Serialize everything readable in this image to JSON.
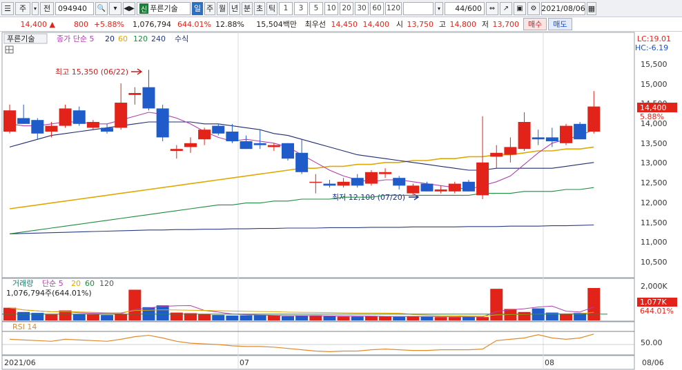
{
  "toolbar": {
    "market_type": "주",
    "prev_label": "전",
    "stock_code": "094940",
    "search_icon": "search-icon",
    "code_history_icon": "history-icon",
    "nav_icon": "arrows-icon",
    "sin_badge": "신",
    "stock_name": "푸른기술",
    "periods": [
      "일",
      "주",
      "월",
      "년",
      "분",
      "초",
      "틱"
    ],
    "active_period": "일",
    "intervals": [
      "1",
      "3",
      "5",
      "10",
      "20",
      "30",
      "60",
      "120"
    ],
    "count_value": "44",
    "count_total": "/600",
    "date": "2021/08/06"
  },
  "quote": {
    "price": "14,400",
    "change": "800",
    "change_pct": "+5.88%",
    "volume": "1,076,794",
    "volume_ratio": "644.01%",
    "turnover": "12.88%",
    "amount": "15,504백만",
    "best_label": "최우선",
    "ask": "14,450",
    "bid": "14,400",
    "open_label": "시",
    "open": "13,750",
    "high_label": "고",
    "high": "14,800",
    "low_label": "저",
    "low": "13,700",
    "buy_label": "매수",
    "sell_label": "매도"
  },
  "legend": {
    "stock_name": "푸른기술",
    "price_ma_prefix": "종가 단순 5",
    "ma_periods": [
      "20",
      "60",
      "120",
      "240"
    ],
    "formula_label": "수식",
    "lc_label": "LC:19.01",
    "hc_label": "HC:-6.19"
  },
  "annotations": {
    "high_note": "최고 15,350 (06/22)",
    "low_note": "최저 12,100 (07/20)"
  },
  "price_axis": {
    "ticks": [
      "15,500",
      "15,000",
      "14,500",
      "14,000",
      "13,500",
      "13,000",
      "12,500",
      "12,000",
      "11,500",
      "11,000",
      "10,500"
    ],
    "current_price": "14,400",
    "current_pct": "5.88%"
  },
  "volume_panel": {
    "title": "거래량",
    "ma_prefix": "단순 5",
    "ma_periods": [
      "20",
      "60",
      "120"
    ],
    "info": "1,076,794주(644.01%)",
    "tick_top": "2,000K",
    "current_volume": "1,077K",
    "current_pct": "644.01%"
  },
  "rsi_panel": {
    "title": "RSI 14",
    "tick": "50.00"
  },
  "x_axis": {
    "labels": [
      "2021/06",
      "07",
      "08"
    ],
    "right_label": "08/06"
  },
  "colors": {
    "up": "#e2231a",
    "down": "#1f5cc9",
    "ma5": "#b040b0",
    "ma20": "#1e2a6e",
    "ma60": "#e0a800",
    "ma120": "#1c8a3c",
    "ma240": "#2a3a80",
    "rsi": "#e08a2a"
  },
  "chart_data": {
    "type": "candlestick",
    "x_range": [
      "2021/06",
      "2021/08/06"
    ],
    "y_range": [
      10300,
      15700
    ],
    "candles": [
      {
        "o": 13750,
        "h": 14450,
        "l": 13700,
        "c": 14300
      },
      {
        "o": 14100,
        "h": 14450,
        "l": 13950,
        "c": 13950
      },
      {
        "o": 14050,
        "h": 14100,
        "l": 13550,
        "c": 13700
      },
      {
        "o": 13750,
        "h": 14000,
        "l": 13600,
        "c": 13900
      },
      {
        "o": 13900,
        "h": 14450,
        "l": 13850,
        "c": 14350
      },
      {
        "o": 14300,
        "h": 14400,
        "l": 13900,
        "c": 13950
      },
      {
        "o": 13850,
        "h": 14050,
        "l": 13800,
        "c": 14000
      },
      {
        "o": 13850,
        "h": 13950,
        "l": 13700,
        "c": 13750
      },
      {
        "o": 13850,
        "h": 15000,
        "l": 13800,
        "c": 14500
      },
      {
        "o": 14700,
        "h": 14900,
        "l": 14450,
        "c": 14750
      },
      {
        "o": 14900,
        "h": 15350,
        "l": 14300,
        "c": 14350
      },
      {
        "o": 14350,
        "h": 14450,
        "l": 13500,
        "c": 13600
      },
      {
        "o": 13250,
        "h": 13400,
        "l": 13050,
        "c": 13300
      },
      {
        "o": 13350,
        "h": 13600,
        "l": 13200,
        "c": 13450
      },
      {
        "o": 13550,
        "h": 13850,
        "l": 13400,
        "c": 13800
      },
      {
        "o": 13900,
        "h": 13950,
        "l": 13650,
        "c": 13700
      },
      {
        "o": 13750,
        "h": 13950,
        "l": 13450,
        "c": 13500
      },
      {
        "o": 13500,
        "h": 13650,
        "l": 13300,
        "c": 13300
      },
      {
        "o": 13450,
        "h": 13800,
        "l": 13300,
        "c": 13400
      },
      {
        "o": 13350,
        "h": 13450,
        "l": 13250,
        "c": 13400
      },
      {
        "o": 13450,
        "h": 13450,
        "l": 13000,
        "c": 13050
      },
      {
        "o": 13200,
        "h": 13550,
        "l": 12650,
        "c": 12700
      },
      {
        "o": 12450,
        "h": 12650,
        "l": 12150,
        "c": 12450
      },
      {
        "o": 12400,
        "h": 12500,
        "l": 12300,
        "c": 12350
      },
      {
        "o": 12350,
        "h": 12550,
        "l": 12300,
        "c": 12450
      },
      {
        "o": 12550,
        "h": 12650,
        "l": 12300,
        "c": 12350
      },
      {
        "o": 12400,
        "h": 12750,
        "l": 12350,
        "c": 12700
      },
      {
        "o": 12650,
        "h": 12800,
        "l": 12550,
        "c": 12700
      },
      {
        "o": 12550,
        "h": 12600,
        "l": 12250,
        "c": 12350
      },
      {
        "o": 12150,
        "h": 12400,
        "l": 12100,
        "c": 12350
      },
      {
        "o": 12400,
        "h": 12450,
        "l": 12200,
        "c": 12200
      },
      {
        "o": 12200,
        "h": 12350,
        "l": 12150,
        "c": 12250
      },
      {
        "o": 12200,
        "h": 12450,
        "l": 12150,
        "c": 12400
      },
      {
        "o": 12450,
        "h": 12500,
        "l": 12200,
        "c": 12200
      },
      {
        "o": 12100,
        "h": 14150,
        "l": 12000,
        "c": 12950
      },
      {
        "o": 13100,
        "h": 13400,
        "l": 12800,
        "c": 13200
      },
      {
        "o": 13150,
        "h": 13600,
        "l": 12950,
        "c": 13350
      },
      {
        "o": 13300,
        "h": 14250,
        "l": 13250,
        "c": 14000
      },
      {
        "o": 13600,
        "h": 13800,
        "l": 13400,
        "c": 13550
      },
      {
        "o": 13600,
        "h": 13850,
        "l": 13350,
        "c": 13500
      },
      {
        "o": 13450,
        "h": 13950,
        "l": 13400,
        "c": 13900
      },
      {
        "o": 13950,
        "h": 14000,
        "l": 13550,
        "c": 13550
      },
      {
        "o": 13750,
        "h": 14800,
        "l": 13700,
        "c": 14400
      }
    ],
    "ma5": [
      13950,
      13900,
      13900,
      13950,
      14000,
      14000,
      13950,
      13950,
      14050,
      14150,
      14250,
      14200,
      14100,
      13950,
      13750,
      13600,
      13500,
      13550,
      13500,
      13450,
      13350,
      13150,
      12950,
      12750,
      12600,
      12500,
      12450,
      12500,
      12500,
      12450,
      12400,
      12350,
      12300,
      12250,
      12350,
      12450,
      12600,
      12900,
      13200,
      13450,
      13550,
      13650,
      13800
    ],
    "ma20": [
      13350,
      13450,
      13550,
      13650,
      13700,
      13750,
      13800,
      13850,
      13900,
      13950,
      14000,
      14000,
      14000,
      14000,
      13950,
      13950,
      13900,
      13850,
      13800,
      13700,
      13650,
      13550,
      13450,
      13350,
      13250,
      13150,
      13100,
      13050,
      13000,
      12950,
      12900,
      12850,
      12800,
      12750,
      12750,
      12800,
      12800,
      12800,
      12800,
      12800,
      12850,
      12900,
      12950
    ],
    "ma60": [
      11750,
      11800,
      11850,
      11900,
      11950,
      12000,
      12050,
      12100,
      12150,
      12200,
      12250,
      12300,
      12350,
      12400,
      12450,
      12500,
      12550,
      12600,
      12650,
      12700,
      12750,
      12800,
      12800,
      12850,
      12850,
      12900,
      12900,
      12950,
      12950,
      13000,
      13000,
      13050,
      13050,
      13100,
      13100,
      13150,
      13150,
      13200,
      13250,
      13250,
      13300,
      13300,
      13350
    ],
    "ma120": [
      11100,
      11150,
      11200,
      11250,
      11300,
      11350,
      11400,
      11450,
      11500,
      11550,
      11600,
      11650,
      11700,
      11750,
      11800,
      11850,
      11850,
      11900,
      11900,
      11950,
      11950,
      12000,
      12000,
      12000,
      12050,
      12050,
      12050,
      12100,
      12100,
      12100,
      12100,
      12100,
      12100,
      12100,
      12150,
      12150,
      12150,
      12200,
      12200,
      12200,
      12250,
      12250,
      12300
    ],
    "ma240": [
      11100,
      11110,
      11120,
      11130,
      11140,
      11150,
      11160,
      11170,
      11180,
      11190,
      11200,
      11200,
      11210,
      11210,
      11220,
      11220,
      11230,
      11230,
      11240,
      11240,
      11250,
      11250,
      11250,
      11260,
      11260,
      11260,
      11270,
      11270,
      11270,
      11280,
      11280,
      11280,
      11280,
      11290,
      11290,
      11290,
      11300,
      11300,
      11300,
      11310,
      11310,
      11320,
      11330
    ],
    "volume_k": [
      420,
      280,
      250,
      200,
      330,
      210,
      200,
      180,
      210,
      1020,
      440,
      500,
      260,
      240,
      210,
      180,
      160,
      170,
      170,
      160,
      140,
      150,
      170,
      140,
      130,
      130,
      140,
      130,
      120,
      140,
      120,
      110,
      110,
      120,
      110,
      1050,
      380,
      280,
      400,
      260,
      220,
      250,
      1077
    ],
    "rsi": [
      58,
      57,
      56,
      55,
      58,
      57,
      56,
      55,
      58,
      62,
      64,
      60,
      55,
      52,
      51,
      50,
      48,
      47,
      47,
      46,
      44,
      42,
      40,
      39,
      40,
      40,
      42,
      43,
      42,
      41,
      41,
      42,
      42,
      42,
      43,
      56,
      58,
      60,
      65,
      60,
      58,
      60,
      66
    ]
  }
}
